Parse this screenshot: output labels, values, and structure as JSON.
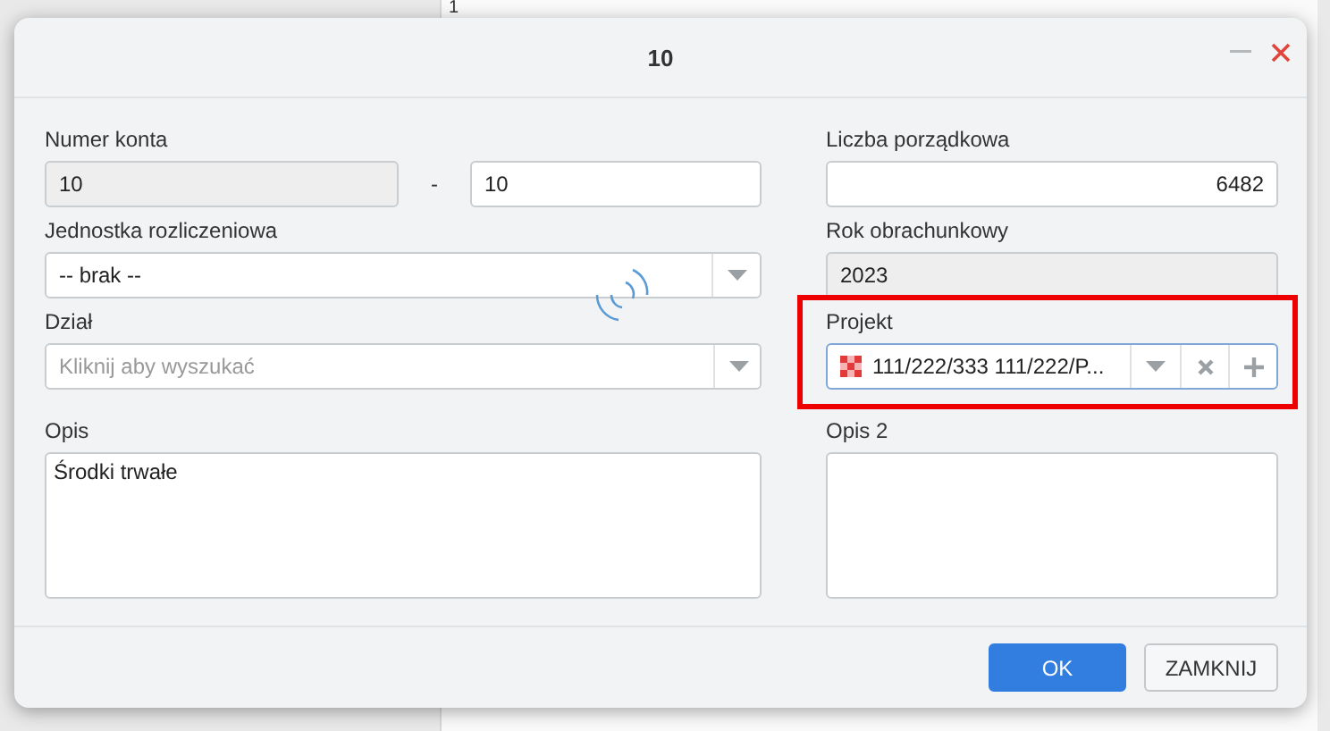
{
  "background": {
    "row_number": "1"
  },
  "dialog": {
    "title": "10",
    "account_number": {
      "label": "Numer konta",
      "prefix": "10",
      "separator": "-",
      "suffix": "10"
    },
    "ordinal": {
      "label": "Liczba porządkowa",
      "value": "6482"
    },
    "unit": {
      "label": "Jednostka rozliczeniowa",
      "value": "-- brak --"
    },
    "year": {
      "label": "Rok obrachunkowy",
      "value": "2023",
      "disabled": true
    },
    "department": {
      "label": "Dział",
      "placeholder": "Kliknij aby wyszukać"
    },
    "project": {
      "label": "Projekt",
      "value": "111/222/333 111/222/P...",
      "highlighted": true
    },
    "description": {
      "label": "Opis",
      "value": "Środki trwałe"
    },
    "description2": {
      "label": "Opis 2"
    },
    "loading": true,
    "buttons": [
      {
        "label": "OK",
        "kind": "primary"
      },
      {
        "label": "ZAMKNIJ",
        "kind": "secondary"
      }
    ]
  }
}
